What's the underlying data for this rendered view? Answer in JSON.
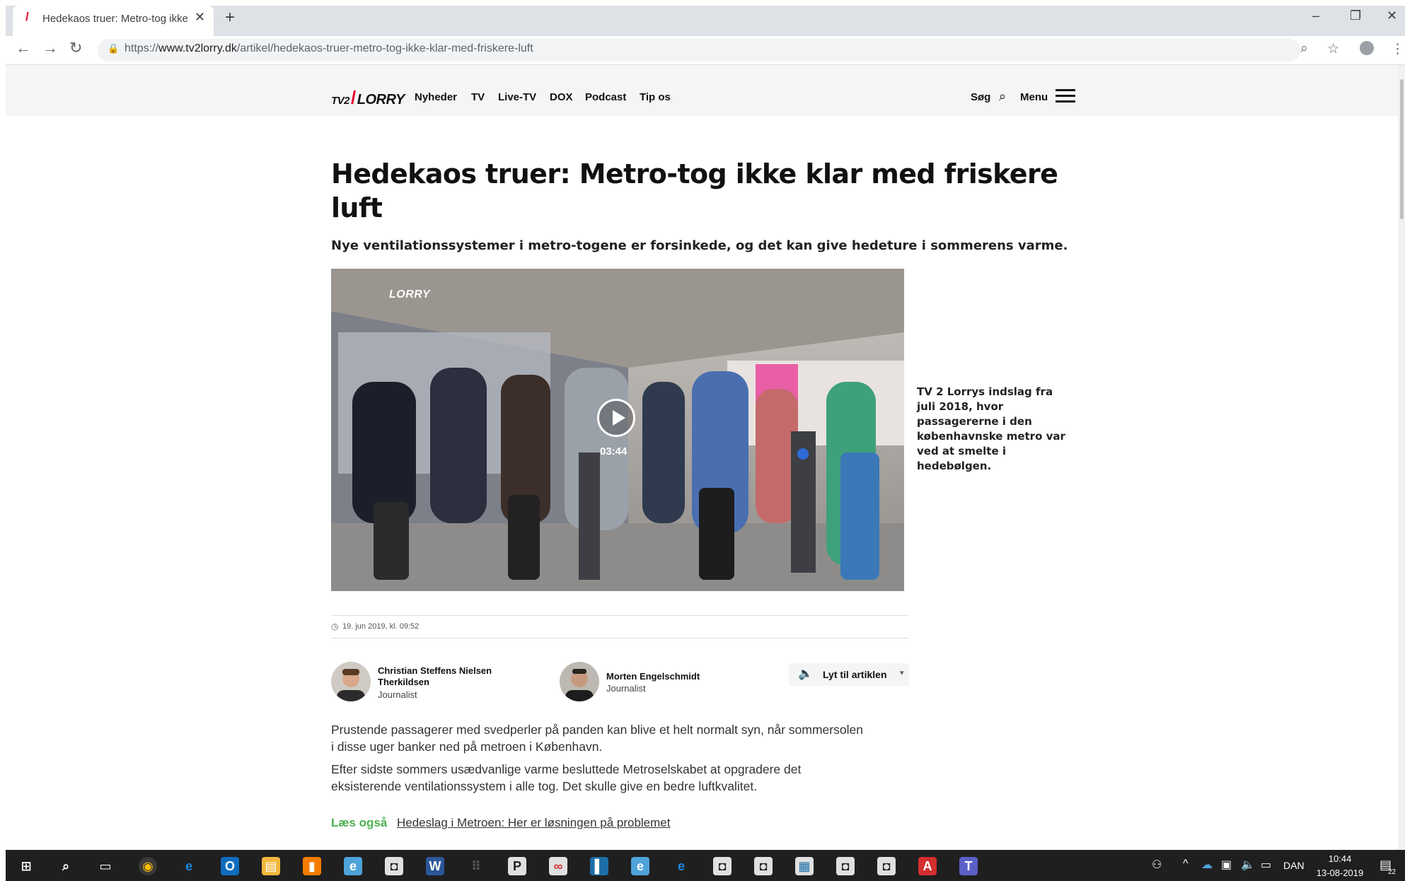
{
  "browser": {
    "tab_title": "Hedekaos truer: Metro-tog ikke k",
    "tab_close": "✕",
    "new_tab": "+",
    "url_prefix": "https://",
    "url_host": "www.tv2lorry.dk",
    "url_path": "/artikel/hedekaos-truer-metro-tog-ikke-klar-med-friskere-luft",
    "window_controls": [
      "–",
      "❐",
      "✕"
    ]
  },
  "site": {
    "logo_prefix": "TV2",
    "logo_name": "LORRY",
    "nav": [
      "Nyheder",
      "TV",
      "Live-TV",
      "DOX",
      "Podcast",
      "Tip os"
    ],
    "search_label": "Søg",
    "menu_label": "Menu"
  },
  "article": {
    "headline": "Hedekaos truer: Metro-tog ikke klar med friskere luft",
    "lead": "Nye ventilationssystemer i metro-togene er forsinkede, og det kan give hedeture i sommerens varme.",
    "video": {
      "channel_logo": "LORRY",
      "duration": "03:44",
      "caption": "TV 2 Lorrys indslag fra juli 2018, hvor passagererne i den københavnske metro var ved at smelte i hedebølgen."
    },
    "date": "19. jun 2019, kl. 09:52",
    "authors": [
      {
        "name": "Christian Steffens Nielsen Therkildsen",
        "role": "Journalist"
      },
      {
        "name": "Morten Engelschmidt",
        "role": "Journalist"
      }
    ],
    "listen_label": "Lyt til artiklen",
    "paragraphs": [
      "Prustende passagerer med svedperler på panden kan blive et helt normalt syn, når sommersolen i disse uger banker ned på metroen i København.",
      "Efter sidste sommers usædvanlige varme besluttede Metroselskabet at opgradere det eksisterende ventilationssystem i alle tog. Det skulle give en bedre luftkvalitet."
    ],
    "read_also_label": "Læs også",
    "read_also_link": "Hedeslag i Metroen: Her er løsningen på problemet"
  },
  "taskbar": {
    "language": "DAN",
    "time": "10:44",
    "date": "13-08-2019",
    "notification_count": "22"
  },
  "colors": {
    "accent_red": "#e4002b",
    "read_also_green": "#4caf50",
    "taskbar": "#1f1f1f"
  }
}
